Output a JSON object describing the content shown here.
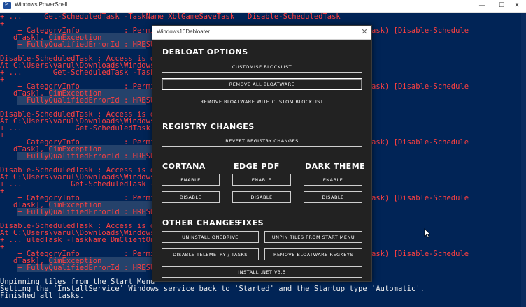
{
  "powershell": {
    "title": "Windows PowerShell",
    "controls": {
      "minimize": "—",
      "maximize": "☐",
      "close": "✕"
    },
    "console_lines": [
      {
        "text": "+ ...     Get-ScheduledTask -TaskName XblGameSaveTask | Disable-ScheduledTask",
        "style": "err"
      },
      {
        "text": "+",
        "style": "err"
      },
      {
        "text": "    + CategoryInfo          : Permi                                      _ScheduledTask) [Disable-Schedule",
        "style": "err"
      },
      {
        "text": "   dTask], CimException",
        "style": "err",
        "hl": [
          11,
          44
        ]
      },
      {
        "text": "    + FullyQualifiedErrorId : HRESU",
        "style": "err",
        "hl": [
          4,
          33
        ]
      },
      {
        "text": "",
        "style": "err"
      },
      {
        "text": "Disable-ScheduledTask : Access is d                                      char:56",
        "style": "err"
      },
      {
        "text": "At C:\\Users\\varul\\Downloads\\Windows",
        "style": "err"
      },
      {
        "text": "+ ...       Get-ScheduledTask -TaskN",
        "style": "err"
      },
      {
        "text": "+",
        "style": "err"
      },
      {
        "text": "    + CategoryInfo          : Permi                                      _ScheduledTask) [Disable-Schedule",
        "style": "err"
      },
      {
        "text": "   dTask], CimException",
        "style": "err",
        "hl": [
          11,
          44
        ]
      },
      {
        "text": "    + FullyQualifiedErrorId : HRESU",
        "style": "err",
        "hl": [
          4,
          33
        ]
      },
      {
        "text": "",
        "style": "err"
      },
      {
        "text": "Disable-ScheduledTask : Access is d                                      char:51",
        "style": "err"
      },
      {
        "text": "At C:\\Users\\varul\\Downloads\\Windows",
        "style": "err"
      },
      {
        "text": "+ ...            Get-ScheduledTask -",
        "style": "err"
      },
      {
        "text": "+",
        "style": "err"
      },
      {
        "text": "    + CategoryInfo          : Permi                                      _ScheduledTask) [Disable-Schedule",
        "style": "err"
      },
      {
        "text": "   dTask], CimException",
        "style": "err",
        "hl": [
          11,
          44
        ]
      },
      {
        "text": "    + FullyQualifiedErrorId : HRESU",
        "style": "err",
        "hl": [
          4,
          33
        ]
      },
      {
        "text": "",
        "style": "err"
      },
      {
        "text": "Disable-ScheduledTask : Access is d                                      char:52",
        "style": "err"
      },
      {
        "text": "At C:\\Users\\varul\\Downloads\\Windows",
        "style": "err"
      },
      {
        "text": "+ ...           Get-ScheduledTask -T",
        "style": "err"
      },
      {
        "text": "+",
        "style": "err"
      },
      {
        "text": "    + CategoryInfo          : Permi                                      _ScheduledTask) [Disable-Schedule",
        "style": "err"
      },
      {
        "text": "   dTask], CimException",
        "style": "err",
        "hl": [
          11,
          44
        ]
      },
      {
        "text": "    + FullyQualifiedErrorId : HRESU",
        "style": "err",
        "hl": [
          4,
          33
        ]
      },
      {
        "text": "",
        "style": "err"
      },
      {
        "text": "Disable-ScheduledTask : Access is d                                      char:70",
        "style": "err"
      },
      {
        "text": "At C:\\Users\\varul\\Downloads\\Windows",
        "style": "err"
      },
      {
        "text": "+ ... uledTask -TaskName DmClientOn",
        "style": "err"
      },
      {
        "text": "+",
        "style": "err"
      },
      {
        "text": "    + CategoryInfo          : Permi                                      _ScheduledTask) [Disable-Schedule",
        "style": "err"
      },
      {
        "text": "   dTask], CimException",
        "style": "err",
        "hl": [
          11,
          44
        ]
      },
      {
        "text": "    + FullyQualifiedErrorId : HRESU",
        "style": "err",
        "hl": [
          4,
          33
        ]
      },
      {
        "text": "",
        "style": "err"
      },
      {
        "text": "Unpinning tiles from the Start Menu",
        "style": "ok"
      },
      {
        "text": "Setting the 'InstallService' Windows service back to 'Started' and the Startup type 'Automatic'.",
        "style": "ok"
      },
      {
        "text": "Finished all tasks.",
        "style": "ok"
      }
    ]
  },
  "debloater": {
    "title": "Windows10Debloater",
    "close": "✕",
    "sections": {
      "debloat_options": "DEBLOAT OPTIONS",
      "registry_changes": "REGISTRY CHANGES",
      "cortana": "CORTANA",
      "edge_pdf": "EDGE PDF",
      "dark_theme": "DARK THEME",
      "other_changes": "OTHER CHANGES",
      "fixes": "FIXES"
    },
    "buttons": {
      "customise_blocklist": "CUSTOMISE BLOCKLIST",
      "remove_all_bloatware": "REMOVE ALL BLOATWARE",
      "remove_custom_blocklist": "REMOVE BLOATWARE WITH CUSTOM BLOCKLIST",
      "revert_registry": "REVERT REGISTRY CHANGES",
      "cortana_enable": "ENABLE",
      "cortana_disable": "DISABLE",
      "edge_enable": "ENABLE",
      "edge_disable": "DISABLE",
      "dark_enable": "ENABLE",
      "dark_disable": "DISABLE",
      "uninstall_onedrive": "UNINSTALL ONEDRIVE",
      "unpin_tiles": "UNPIN TILES FROM START MENU",
      "disable_telemetry": "DISABLE TELEMETRY / TASKS",
      "remove_regkeys": "REMOVE BLOATWARE REGKEYS",
      "install_net": "INSTALL .NET V3.5"
    }
  }
}
